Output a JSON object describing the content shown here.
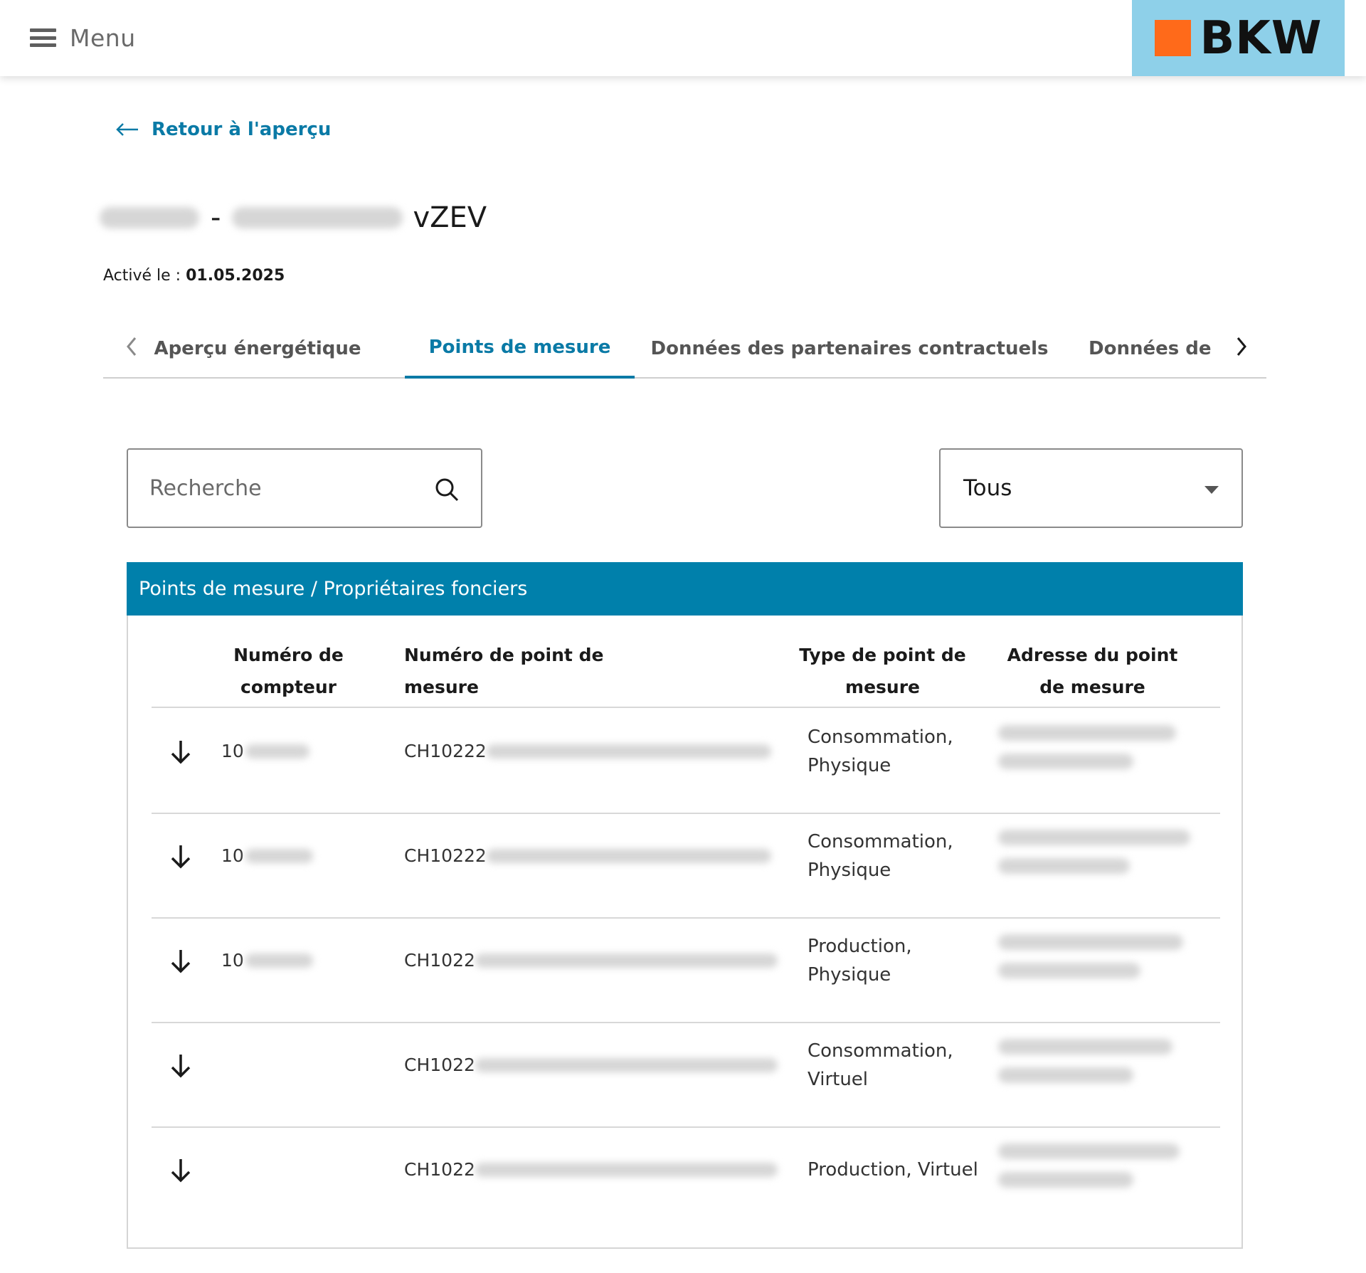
{
  "header": {
    "menu_label": "Menu",
    "logo_text": "BKW",
    "logo_bg_color": "#8ed0e9",
    "logo_square_color": "#ff6a1a"
  },
  "back_link": {
    "label": "Retour à l'aperçu"
  },
  "page_title": {
    "suffix": "vZEV",
    "separator": "-"
  },
  "activated": {
    "label": "Activé le :",
    "date": "01.05.2025"
  },
  "tabs": [
    {
      "label": "Aperçu énergétique",
      "active": false
    },
    {
      "label": "Points de mesure",
      "active": true
    },
    {
      "label": "Données des partenaires contractuels",
      "active": false
    },
    {
      "label": "Données de m",
      "active": false
    }
  ],
  "search": {
    "placeholder": "Recherche",
    "value": ""
  },
  "filter": {
    "selected": "Tous"
  },
  "table": {
    "title": "Points de mesure / Propriétaires fonciers",
    "header_color": "#0080ab",
    "columns": {
      "meter_number": "Numéro de compteur",
      "point_number": "Numéro de point de mesure",
      "point_type": "Type de point de mesure",
      "point_address": "Adresse du point de mesure"
    },
    "rows": [
      {
        "meter_number": "10",
        "point_number": "CH10222",
        "point_type": "Consommation, Physique"
      },
      {
        "meter_number": "10",
        "point_number": "CH10222",
        "point_type": "Consommation, Physique"
      },
      {
        "meter_number": "10",
        "point_number": "CH1022",
        "point_type": "Production, Physique"
      },
      {
        "meter_number": "",
        "point_number": "CH1022",
        "point_type": "Consommation, Virtuel"
      },
      {
        "meter_number": "",
        "point_number": "CH1022",
        "point_type": "Production, Virtuel"
      }
    ]
  }
}
